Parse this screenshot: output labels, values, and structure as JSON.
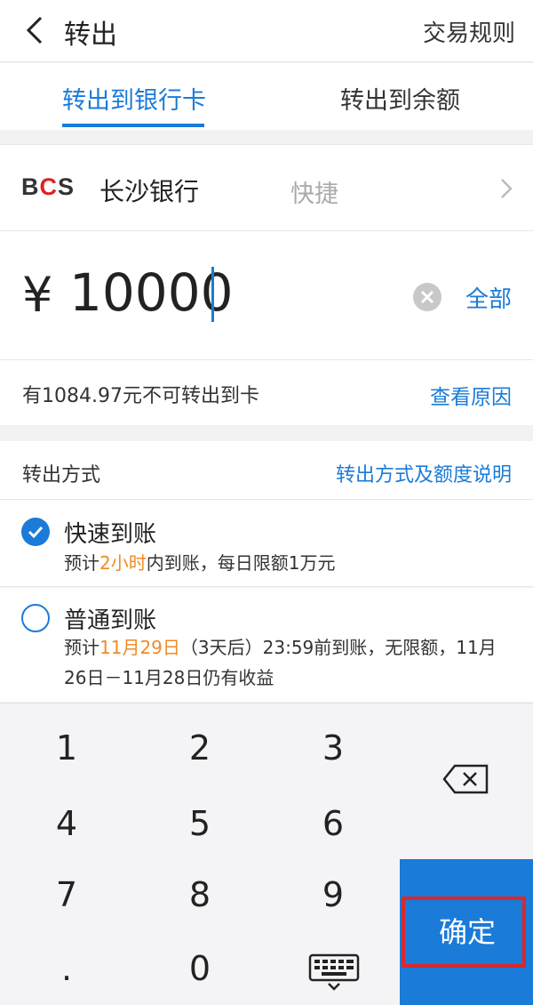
{
  "header": {
    "title": "转出",
    "rules": "交易规则"
  },
  "tabs": [
    {
      "label": "转出到银行卡",
      "active": true
    },
    {
      "label": "转出到余额",
      "active": false
    }
  ],
  "bank": {
    "logo_text": "BCS",
    "name": "长沙银行",
    "type": "快捷"
  },
  "amount": {
    "currency": "¥",
    "value": "10000",
    "all_label": "全部"
  },
  "notice": {
    "text": "有1084.97元不可转出到卡",
    "link": "查看原因"
  },
  "method": {
    "label": "转出方式",
    "link": "转出方式及额度说明",
    "options": [
      {
        "title": "快速到账",
        "selected": true,
        "desc_pre": "预计",
        "desc_highlight": "2小时",
        "desc_post": "内到账，每日限额1万元"
      },
      {
        "title": "普通到账",
        "selected": false,
        "desc_pre": "预计",
        "desc_highlight": "11月29日",
        "desc_post": "（3天后）23:59前到账，无限额，11月26日－11月28日仍有收益"
      }
    ]
  },
  "keypad": {
    "keys": [
      "1",
      "2",
      "3",
      "4",
      "5",
      "6",
      "7",
      "8",
      "9",
      ".",
      "0"
    ],
    "confirm": "确定"
  },
  "colors": {
    "accent": "#1a7bd8",
    "highlight": "#f08a24",
    "confirm_outline": "#d9282e"
  }
}
